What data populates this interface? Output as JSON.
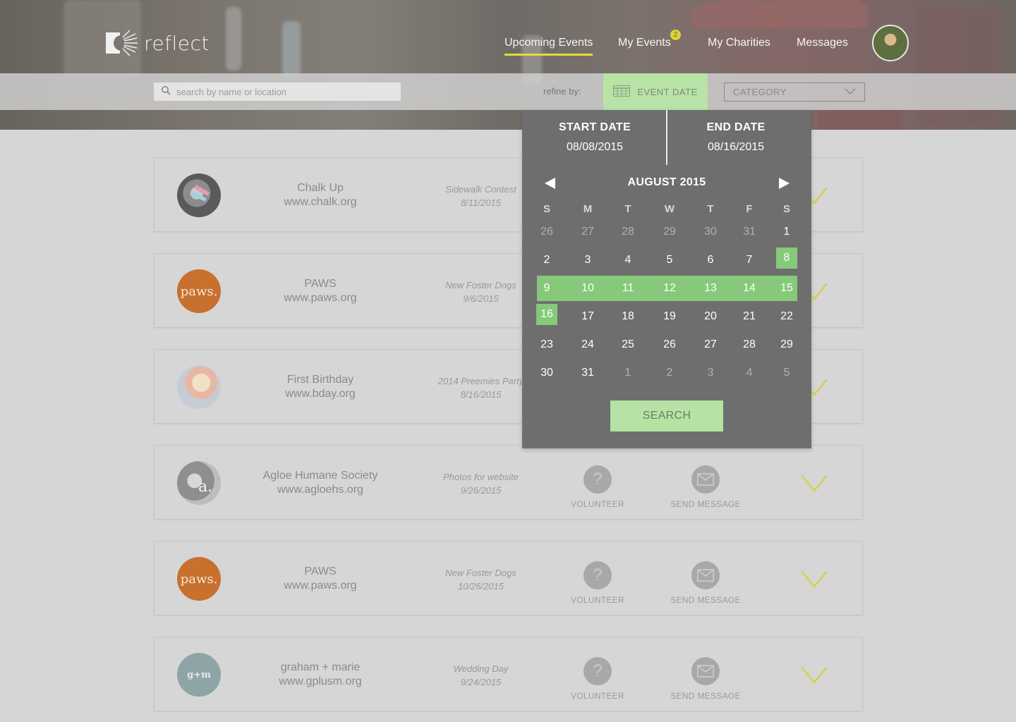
{
  "brand": {
    "name": "reflect"
  },
  "nav": {
    "items": [
      {
        "label": "Upcoming Events",
        "active": true
      },
      {
        "label": "My Events",
        "badge": "2"
      },
      {
        "label": "My Charities"
      },
      {
        "label": "Messages"
      }
    ]
  },
  "filter": {
    "search_placeholder": "search by name or location",
    "refine_label": "refine by:",
    "event_date_label": "EVENT DATE",
    "category_label": "CATEGORY"
  },
  "calendar": {
    "start_label": "START DATE",
    "start_value": "08/08/2015",
    "end_label": "END DATE",
    "end_value": "08/16/2015",
    "month_label": "AUGUST 2015",
    "weekdays": [
      "S",
      "M",
      "T",
      "W",
      "T",
      "F",
      "S"
    ],
    "weeks": [
      [
        "26",
        "27",
        "28",
        "29",
        "30",
        "31",
        "1"
      ],
      [
        "2",
        "3",
        "4",
        "5",
        "6",
        "7",
        "8"
      ],
      [
        "9",
        "10",
        "11",
        "12",
        "13",
        "14",
        "15"
      ],
      [
        "16",
        "17",
        "18",
        "19",
        "20",
        "21",
        "22"
      ],
      [
        "23",
        "24",
        "25",
        "26",
        "27",
        "28",
        "29"
      ],
      [
        "30",
        "31",
        "1",
        "2",
        "3",
        "4",
        "5"
      ]
    ],
    "search_label": "SEARCH"
  },
  "events": [
    {
      "org": "Chalk Up",
      "url": "www.chalk.org",
      "title": "Sidewalk Contest",
      "date": "8/11/2015",
      "logo": "chalk-photo"
    },
    {
      "org": "PAWS",
      "url": "www.paws.org",
      "title": "New Foster Dogs",
      "date": "9/6/2015",
      "logo": "paws"
    },
    {
      "org": "First Birthday",
      "url": "www.bday.org",
      "title": "2014 Preemies Party",
      "date": "8/16/2015",
      "logo": "baby-photo"
    },
    {
      "org": "Agloe Humane Society",
      "url": "www.agloehs.org",
      "title": "Photos for website",
      "date": "9/26/2015",
      "logo": "cat-photo"
    },
    {
      "org": "PAWS",
      "url": "www.paws.org",
      "title": "New Foster Dogs",
      "date": "10/26/2015",
      "logo": "paws"
    },
    {
      "org": "graham + marie",
      "url": "www.gplusm.org",
      "title": "Wedding Day",
      "date": "9/24/2015",
      "logo": "g+m"
    }
  ],
  "actions": {
    "volunteer_label": "VOLUNTEER",
    "message_label": "SEND MESSAGE"
  },
  "logo_texts": {
    "paws": "paws.",
    "gm": "g+m"
  },
  "colors": {
    "accent_yellow": "#e2dd3a",
    "range_green": "#86c97a",
    "button_green": "#b6e3a3",
    "panel_gray": "#6e6e6e"
  }
}
